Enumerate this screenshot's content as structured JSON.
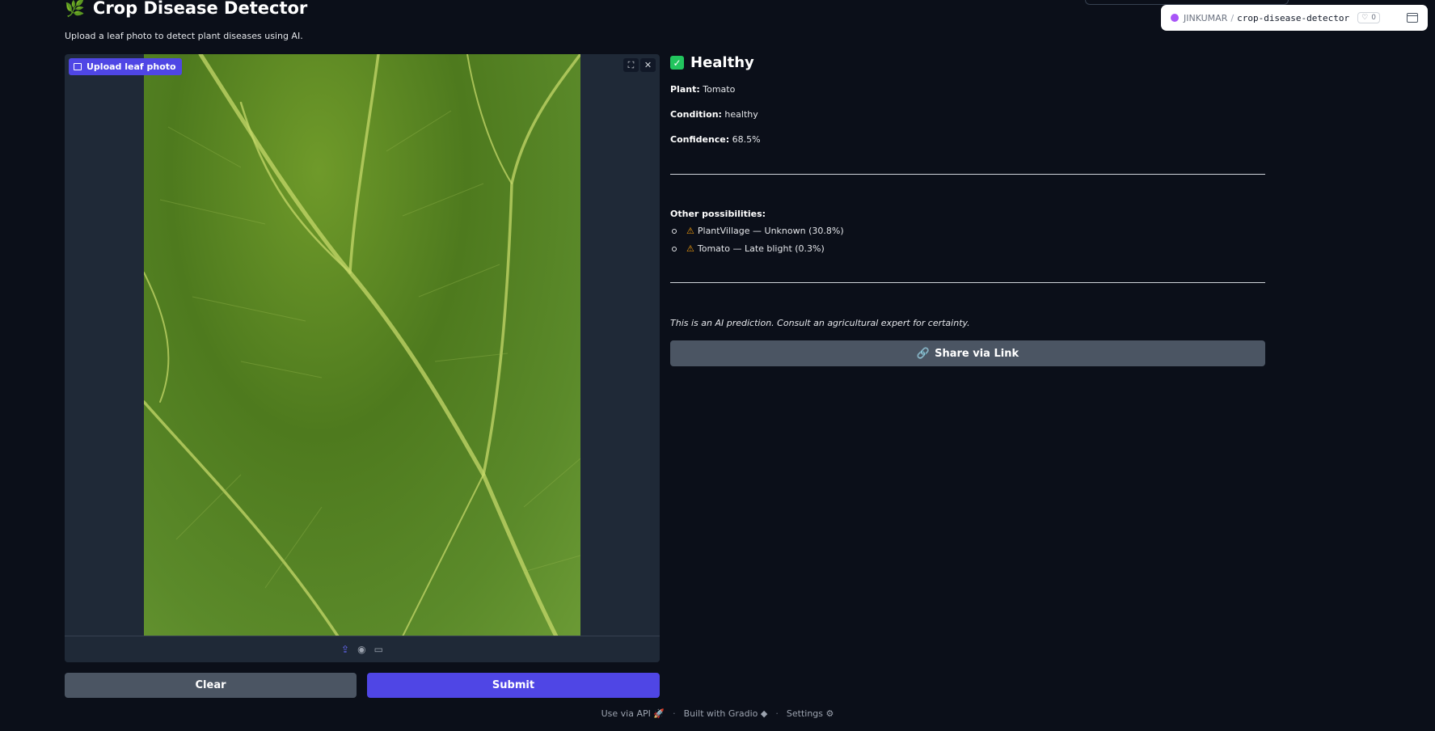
{
  "header": {
    "title_emoji": "🌿",
    "title": "Crop Disease Detector",
    "subtitle": "Upload a leaf photo to detect plant diseases using AI."
  },
  "space_badge": {
    "owner": "JINKUMAR",
    "separator": "/",
    "repo": "crop-disease-detector",
    "likes": "0",
    "accent_color": "#a855f7"
  },
  "image_input": {
    "label": "Upload leaf photo",
    "sources": [
      "upload-icon",
      "webcam-icon",
      "clipboard-icon"
    ]
  },
  "buttons": {
    "clear": "Clear",
    "submit": "Submit",
    "share": "Share via Link"
  },
  "result": {
    "status_icon": "check-icon",
    "status": "Healthy",
    "plant_label": "Plant:",
    "plant": "Tomato",
    "condition_label": "Condition:",
    "condition": "healthy",
    "confidence_label": "Confidence:",
    "confidence": "68.5%",
    "other_heading": "Other possibilities:",
    "others": [
      {
        "icon": "warning-icon",
        "text": "PlantVillage — Unknown (30.8%)"
      },
      {
        "icon": "warning-icon",
        "text": "Tomato — Late blight (0.3%)"
      }
    ],
    "disclaimer": "This is an AI prediction. Consult an agricultural expert for certainty."
  },
  "footer": {
    "api": "Use via API",
    "built": "Built with Gradio",
    "settings": "Settings"
  },
  "colors": {
    "background": "#0b0f19",
    "panel": "#1f2937",
    "primary": "#4f46e5",
    "secondary": "#4b5563",
    "success": "#22c55e",
    "warning": "#f59e0b"
  }
}
